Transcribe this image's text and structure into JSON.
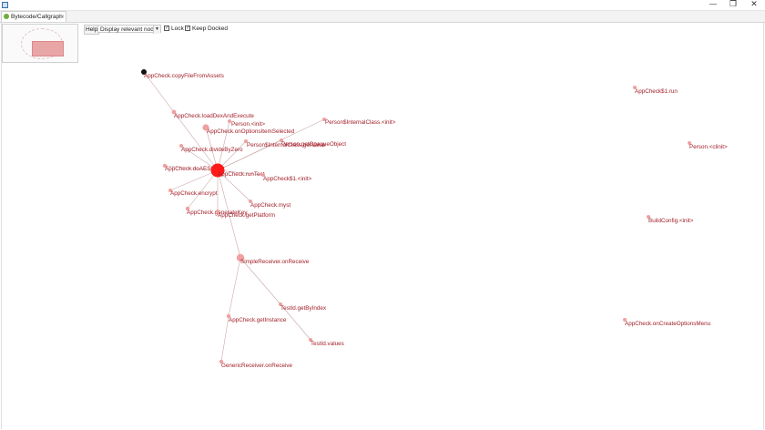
{
  "window": {
    "minimize_glyph": "—",
    "maximize_glyph": "❐",
    "close_glyph": "✕"
  },
  "tab": {
    "label": "Bytecode/Callgraph",
    "close_glyph": "✕",
    "icon": "callgraph-icon"
  },
  "toolbar": {
    "help_label": "Help",
    "filter_value": "Display relevant nodes",
    "lock_label": "Lock",
    "lock_checked": "✓",
    "keep_docked_label": "Keep Docked",
    "keep_docked_checked": "✓"
  },
  "graph": {
    "nodes": [
      {
        "id": "n_copyFile",
        "label": "AppCheck.copyFileFromAssets"
      },
      {
        "id": "n_loadDex",
        "label": "AppCheck.loadDexAndExecute"
      },
      {
        "id": "n_personInit",
        "label": "Person.<init>"
      },
      {
        "id": "n_onOptionsItem",
        "label": "AppCheck.onOptionsItemSelected"
      },
      {
        "id": "n_personInternalInit",
        "label": "Person$InternalClass.<init>"
      },
      {
        "id": "n_divideByZero",
        "label": "AppCheck.divideByZero"
      },
      {
        "id": "n_personInternalGet",
        "label": "Person$InternalClass.getValue"
      },
      {
        "id": "n_getOpaque",
        "label": "Person.getOpaqueObject"
      },
      {
        "id": "n_doAES",
        "label": "AppCheck.doAESCrypt"
      },
      {
        "id": "n_runTest",
        "label": "AppCheck.runTest"
      },
      {
        "id": "n_check1Init",
        "label": "AppCheck$1.<init>"
      },
      {
        "id": "n_encrypt",
        "label": "AppCheck.encrypt"
      },
      {
        "id": "n_myst",
        "label": "AppCheck.myst"
      },
      {
        "id": "n_generateKey",
        "label": "AppCheck.generateKey"
      },
      {
        "id": "n_getPlatform",
        "label": "AppCheck.getPlatform"
      },
      {
        "id": "n_simpleReceiver",
        "label": "SimpleReceiver.onReceive"
      },
      {
        "id": "n_testIdGet",
        "label": "TestId.getByIndex"
      },
      {
        "id": "n_getInstance",
        "label": "AppCheck.getInstance"
      },
      {
        "id": "n_testIdValues",
        "label": "TestId.values"
      },
      {
        "id": "n_genericReceiver",
        "label": "GenericReceiver.onReceive"
      },
      {
        "id": "n_check1Run",
        "label": "AppCheck$1.run"
      },
      {
        "id": "n_personClinit",
        "label": "Person.<clinit>"
      },
      {
        "id": "n_buildConfig",
        "label": "BuildConfig.<init>"
      },
      {
        "id": "n_onCreateOptions",
        "label": "AppCheck.onCreateOptionsMenu"
      }
    ]
  },
  "colors": {
    "node_label": "#a2202a",
    "node_small": "#f0a0a0",
    "node_hub": "#ff1a1a",
    "node_root": "#111111",
    "edge": "#c9a9a9",
    "overview_rect": "#e9a6a6"
  }
}
